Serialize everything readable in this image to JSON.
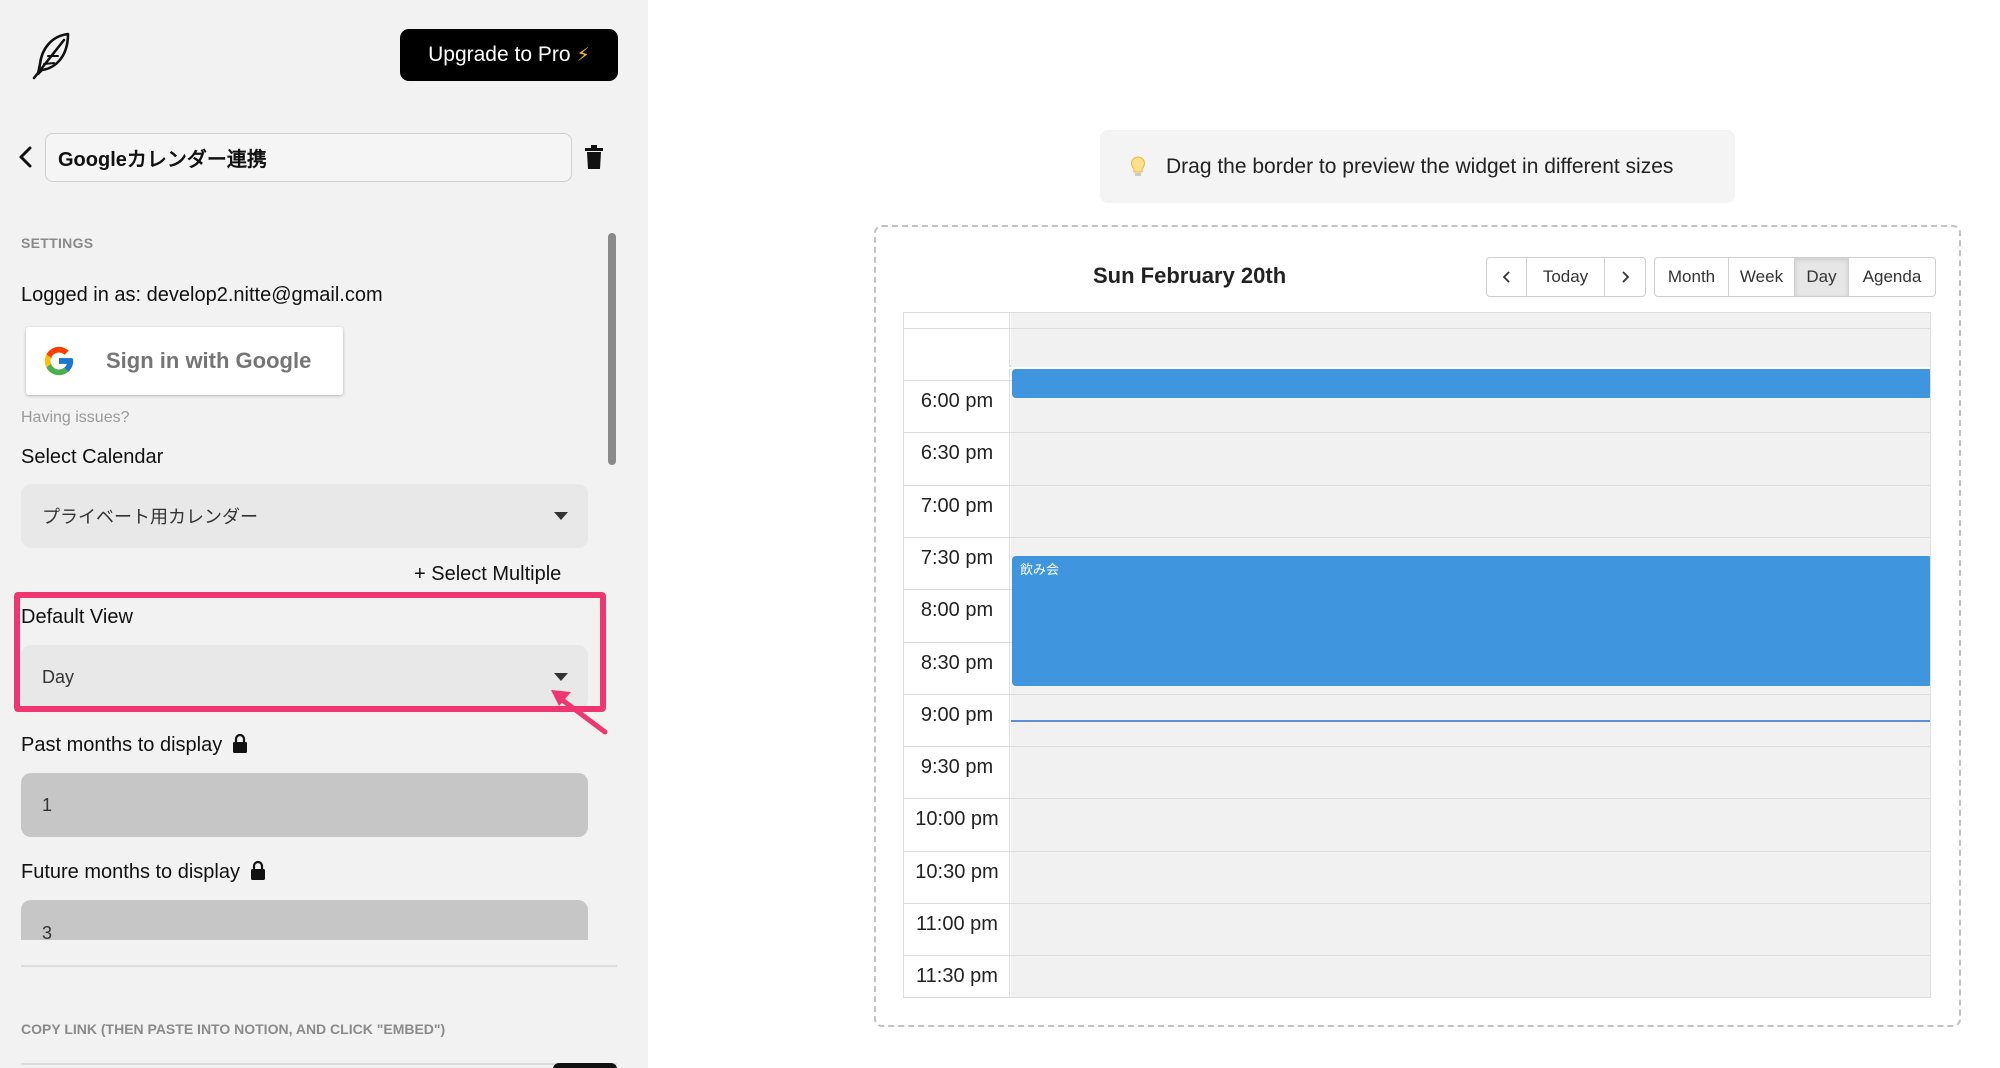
{
  "toolbar": {
    "upgrade_label": "Upgrade to Pro",
    "upgrade_icon": "⚡"
  },
  "widget_name": "Googleカレンダー連携",
  "settings": {
    "section_title": "SETTINGS",
    "logged_in_label": "Logged in as: develop2.nitte@gmail.com",
    "google_button_label": "Sign in with Google",
    "having_issues": "Having issues?",
    "select_calendar_label": "Select Calendar",
    "select_calendar_value": "プライベート用カレンダー",
    "select_multiple": "+ Select Multiple",
    "default_view_label": "Default View",
    "default_view_value": "Day",
    "past_months_label": "Past months to display",
    "past_months_value": "1",
    "future_months_label": "Future months to display",
    "future_months_value": "3",
    "copy_link_title": "COPY LINK (THEN PASTE INTO NOTION, AND CLICK \"EMBED\")"
  },
  "preview": {
    "tip": "Drag the border to preview the widget in different sizes",
    "calendar": {
      "title": "Sun February 20th",
      "nav": {
        "today": "Today"
      },
      "views": [
        "Month",
        "Week",
        "Day",
        "Agenda"
      ],
      "active_view": "Day",
      "time_slots": [
        "6:00 pm",
        "6:30 pm",
        "7:00 pm",
        "7:30 pm",
        "8:00 pm",
        "8:30 pm",
        "9:00 pm",
        "9:30 pm",
        "10:00 pm",
        "10:30 pm",
        "11:00 pm",
        "11:30 pm"
      ],
      "events": [
        {
          "title": ""
        },
        {
          "title": "飲み会"
        }
      ]
    }
  },
  "colors": {
    "accent_highlight": "#ef3672",
    "event_blue": "#3f96de",
    "upgrade_bg": "#000000"
  }
}
